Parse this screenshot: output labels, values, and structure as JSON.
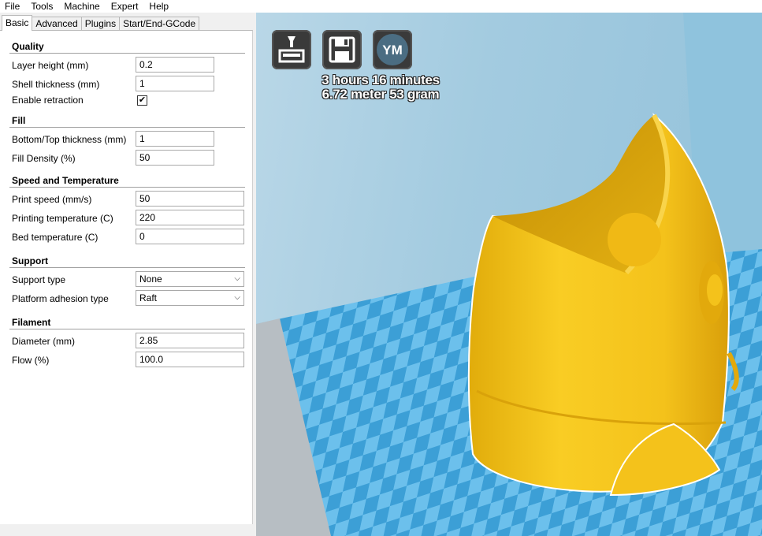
{
  "menu": [
    "File",
    "Tools",
    "Machine",
    "Expert",
    "Help"
  ],
  "tabs": [
    "Basic",
    "Advanced",
    "Plugins",
    "Start/End-GCode"
  ],
  "sections": {
    "quality": {
      "title": "Quality",
      "layer_height": {
        "label": "Layer height (mm)",
        "value": "0.2"
      },
      "shell_thickness": {
        "label": "Shell thickness (mm)",
        "value": "1"
      },
      "enable_retraction": {
        "label": "Enable retraction",
        "checked": "✔"
      }
    },
    "fill": {
      "title": "Fill",
      "bottom_top_thickness": {
        "label": "Bottom/Top thickness (mm)",
        "value": "1"
      },
      "fill_density": {
        "label": "Fill Density (%)",
        "value": "50"
      }
    },
    "speed": {
      "title": "Speed and Temperature",
      "print_speed": {
        "label": "Print speed (mm/s)",
        "value": "50"
      },
      "printing_temperature": {
        "label": "Printing temperature (C)",
        "value": "220"
      },
      "bed_temperature": {
        "label": "Bed temperature (C)",
        "value": "0"
      }
    },
    "support": {
      "title": "Support",
      "support_type": {
        "label": "Support type",
        "value": "None"
      },
      "platform_adhesion": {
        "label": "Platform adhesion type",
        "value": "Raft"
      }
    },
    "filament": {
      "title": "Filament",
      "diameter": {
        "label": "Diameter (mm)",
        "value": "2.85"
      },
      "flow": {
        "label": "Flow (%)",
        "value": "100.0"
      }
    }
  },
  "viewport": {
    "buttons": {
      "load_icon": "load-icon",
      "save_icon": "save-icon",
      "ym_label": "YM"
    },
    "print_time": "3 hours 16 minutes",
    "print_material": "6.72 meter 53 gram",
    "colors": {
      "model": "#f4c21b",
      "platform_light": "#6cc0ec",
      "platform_dark": "#3c9fd6",
      "background": "#a6cce1"
    }
  }
}
